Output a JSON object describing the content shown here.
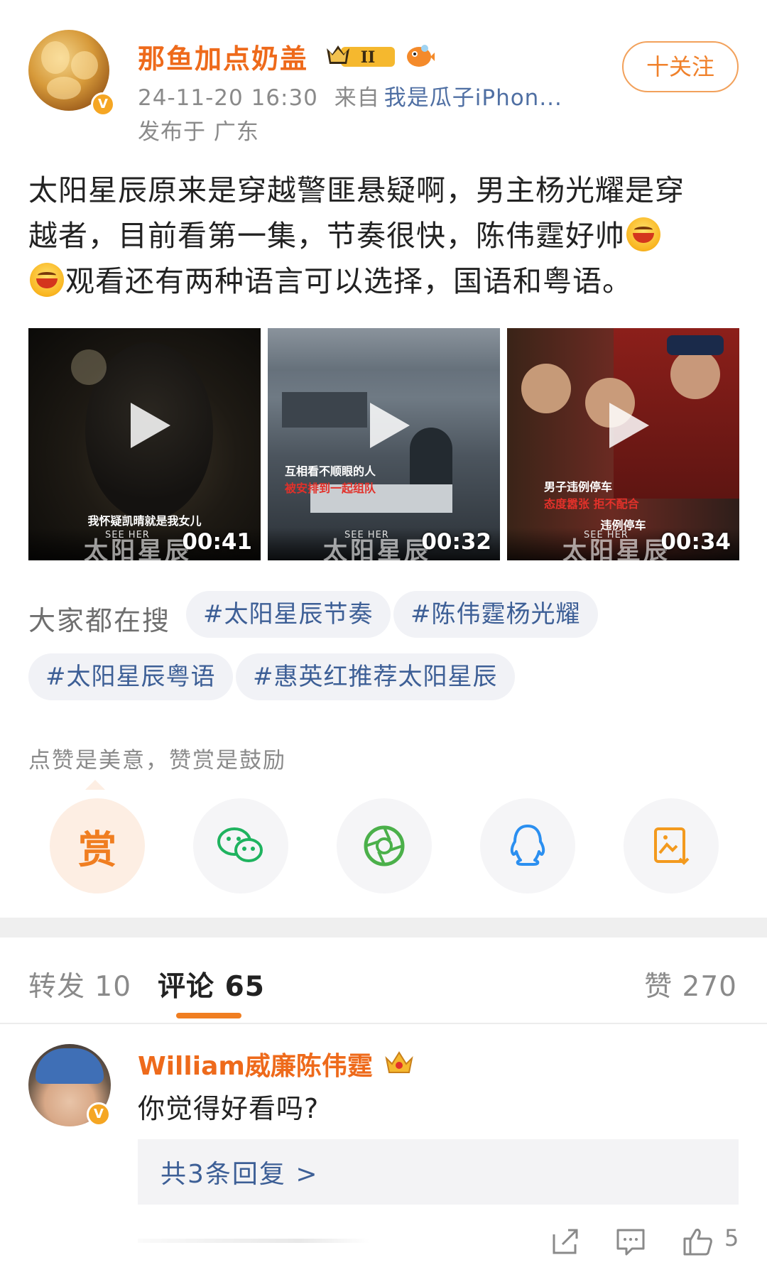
{
  "post": {
    "author": "那鱼加点奶盖",
    "crown_level": "II",
    "timestamp": "24-11-20 16:30",
    "via_prefix": "来自",
    "via_source": "我是瓜子iPhon...",
    "location": "发布于 广东",
    "follow_label": "十关注",
    "text_line1": "太阳星辰原来是穿越警匪悬疑啊，男主杨光耀是穿",
    "text_line2": "越者，目前看第一集，节奏很快，陈伟霆好帅",
    "text_line3": "观看还有两种语言可以选择，国语和粤语。"
  },
  "videos": [
    {
      "subtitle": "我怀疑凯晴就是我女儿",
      "see_her": "SEE HER",
      "series_title": "太阳星辰",
      "duration": "00:41"
    },
    {
      "subtitle": "互相看不顺眼的人",
      "subtitle_red": "被安排到一起组队",
      "see_her": "SEE HER",
      "series_title": "太阳星辰",
      "duration": "00:32"
    },
    {
      "subtitle": "男子违例停车",
      "subtitle_red": "态度嚣张 拒不配合",
      "subtitle_bottom": "违例停车",
      "see_her": "SEE HER",
      "series_title": "太阳星辰",
      "duration": "00:34"
    }
  ],
  "search": {
    "label": "大家都在搜",
    "tags": [
      "#太阳星辰节奏",
      "#陈伟霆杨光耀",
      "#太阳星辰粤语",
      "#惠英红推荐太阳星辰"
    ]
  },
  "reward": {
    "text": "点赞是美意，赞赏是鼓励",
    "reward_button": "赏",
    "share_targets": [
      "wechat-icon",
      "moments-icon",
      "qq-icon",
      "save-image-icon"
    ]
  },
  "tabs": {
    "forward": "转发 10",
    "comment": "评论 65",
    "like": "赞 270"
  },
  "comment": {
    "author": "William威廉陈伟霆",
    "text": "你觉得好看吗?",
    "replies": "共3条回复 >",
    "like_count": "5"
  },
  "colors": {
    "accent_orange": "#ee6a1b",
    "link_blue": "#3d5f96",
    "tag_bg": "#f1f2f6",
    "reward_bg": "#fdeee3"
  }
}
